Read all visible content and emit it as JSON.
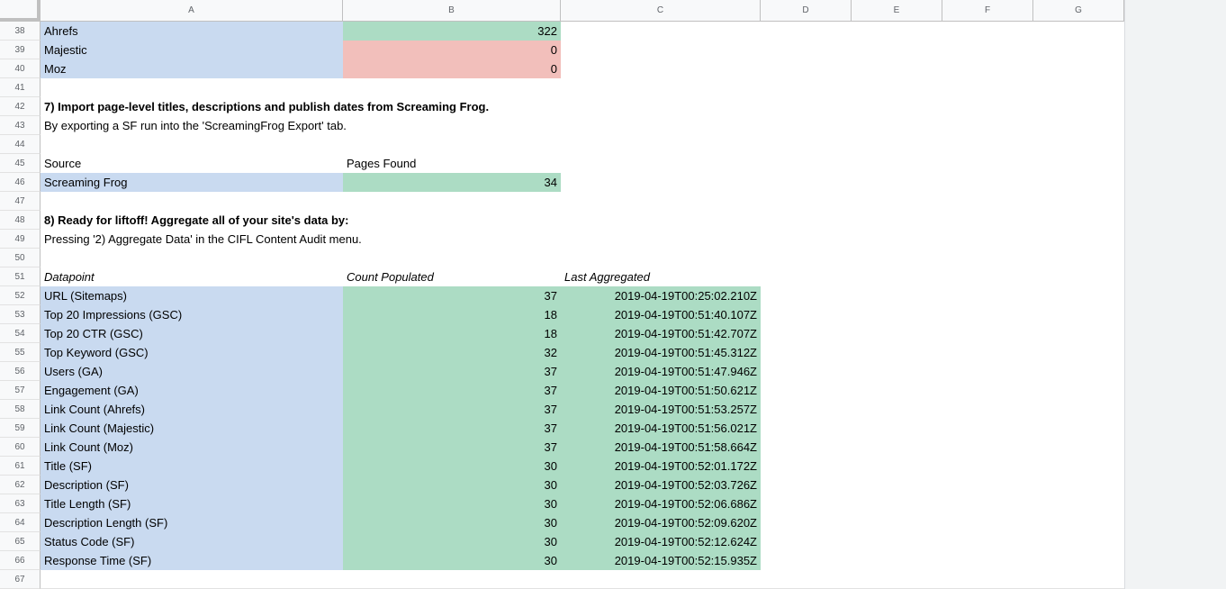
{
  "columns": [
    "A",
    "B",
    "C",
    "D",
    "E",
    "F",
    "G"
  ],
  "rows": [
    "38",
    "39",
    "40",
    "41",
    "42",
    "43",
    "44",
    "45",
    "46",
    "47",
    "48",
    "49",
    "50",
    "51",
    "52",
    "53",
    "54",
    "55",
    "56",
    "57",
    "58",
    "59",
    "60",
    "61",
    "62",
    "63",
    "64",
    "65",
    "66",
    "67"
  ],
  "links": [
    {
      "source": "Ahrefs",
      "value": "322",
      "status": "ok"
    },
    {
      "source": "Majestic",
      "value": "0",
      "status": "missing"
    },
    {
      "source": "Moz",
      "value": "0",
      "status": "missing"
    }
  ],
  "step7": {
    "title": "7) Import page-level titles, descriptions and publish dates from Screaming Frog.",
    "desc": "By exporting a SF run into the 'ScreamingFrog Export' tab.",
    "col_source": "Source",
    "col_pages": "Pages Found",
    "row_source": "Screaming Frog",
    "row_pages": "34"
  },
  "step8": {
    "title": "8) Ready for liftoff!  Aggregate all of your site's data by:",
    "desc": "Pressing '2) Aggregate Data' in the CIFL Content Audit menu.",
    "col_datapoint": "Datapoint",
    "col_count": "Count Populated",
    "col_last": "Last Aggregated"
  },
  "datapoints": [
    {
      "name": "URL (Sitemaps)",
      "count": "37",
      "last": "2019-04-19T00:25:02.210Z"
    },
    {
      "name": "Top 20 Impressions (GSC)",
      "count": "18",
      "last": "2019-04-19T00:51:40.107Z"
    },
    {
      "name": "Top 20 CTR (GSC)",
      "count": "18",
      "last": "2019-04-19T00:51:42.707Z"
    },
    {
      "name": "Top Keyword (GSC)",
      "count": "32",
      "last": "2019-04-19T00:51:45.312Z"
    },
    {
      "name": "Users (GA)",
      "count": "37",
      "last": "2019-04-19T00:51:47.946Z"
    },
    {
      "name": "Engagement (GA)",
      "count": "37",
      "last": "2019-04-19T00:51:50.621Z"
    },
    {
      "name": "Link Count (Ahrefs)",
      "count": "37",
      "last": "2019-04-19T00:51:53.257Z"
    },
    {
      "name": "Link Count (Majestic)",
      "count": "37",
      "last": "2019-04-19T00:51:56.021Z"
    },
    {
      "name": "Link Count (Moz)",
      "count": "37",
      "last": "2019-04-19T00:51:58.664Z"
    },
    {
      "name": "Title (SF)",
      "count": "30",
      "last": "2019-04-19T00:52:01.172Z"
    },
    {
      "name": "Description (SF)",
      "count": "30",
      "last": "2019-04-19T00:52:03.726Z"
    },
    {
      "name": "Title Length (SF)",
      "count": "30",
      "last": "2019-04-19T00:52:06.686Z"
    },
    {
      "name": "Description Length (SF)",
      "count": "30",
      "last": "2019-04-19T00:52:09.620Z"
    },
    {
      "name": "Status Code (SF)",
      "count": "30",
      "last": "2019-04-19T00:52:12.624Z"
    },
    {
      "name": "Response Time (SF)",
      "count": "30",
      "last": "2019-04-19T00:52:15.935Z"
    }
  ],
  "colors": {
    "blue": "#c9daf0",
    "green": "#acdcc4",
    "red": "#f2bfbb"
  }
}
